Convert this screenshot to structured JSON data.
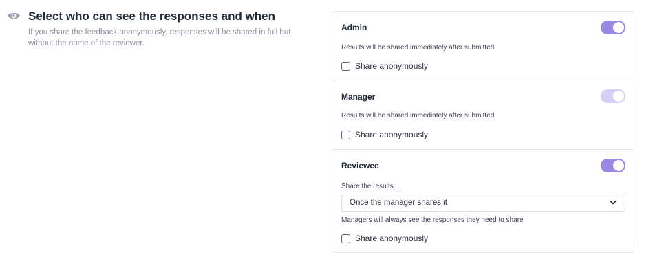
{
  "header": {
    "icon": "eye-icon",
    "title": "Select who can see the responses and when",
    "description": "If you share the feedback anonymously, responses will be shared in full but without the name of the reviewer."
  },
  "roles": [
    {
      "name": "Admin",
      "toggle_on": true,
      "note": "Results will be shared immediately after submitted",
      "share_anonymously_label": "Share anonymously",
      "share_anonymously_checked": false
    },
    {
      "name": "Manager",
      "toggle_on": true,
      "toggle_disabled": true,
      "note": "Results will be shared immediately after submitted",
      "share_anonymously_label": "Share anonymously",
      "share_anonymously_checked": false
    },
    {
      "name": "Reviewee",
      "toggle_on": true,
      "select_label": "Share the results...",
      "select_value": "Once the manager shares it",
      "note": "Managers will always see the responses they need to share",
      "share_anonymously_label": "Share anonymously",
      "share_anonymously_checked": false
    }
  ],
  "colors": {
    "toggle_on": "#9b87e4",
    "toggle_disabled": "#d7cff4",
    "border": "#e3e5ea"
  }
}
